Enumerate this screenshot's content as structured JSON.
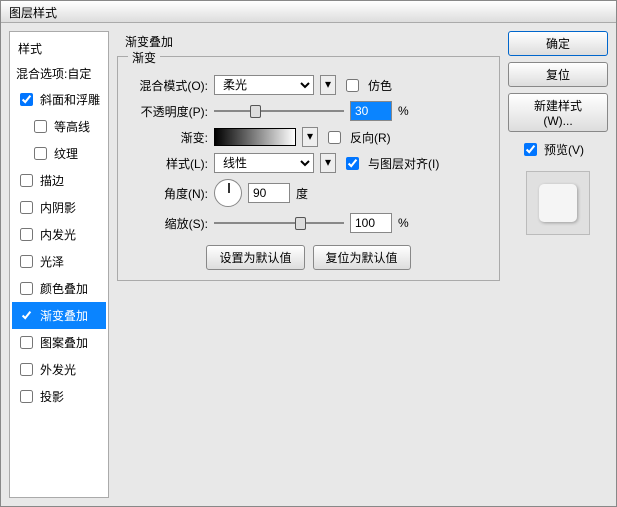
{
  "window": {
    "title": "图层样式"
  },
  "sidebar": {
    "title": "样式",
    "blend_option": "混合选项:自定",
    "items": [
      {
        "label": "斜面和浮雕",
        "checked": true
      },
      {
        "label": "等高线",
        "checked": false,
        "child": true
      },
      {
        "label": "纹理",
        "checked": false,
        "child": true
      },
      {
        "label": "描边",
        "checked": false
      },
      {
        "label": "内阴影",
        "checked": false
      },
      {
        "label": "内发光",
        "checked": false
      },
      {
        "label": "光泽",
        "checked": false
      },
      {
        "label": "颜色叠加",
        "checked": false
      },
      {
        "label": "渐变叠加",
        "checked": true,
        "selected": true
      },
      {
        "label": "图案叠加",
        "checked": false
      },
      {
        "label": "外发光",
        "checked": false
      },
      {
        "label": "投影",
        "checked": false
      }
    ]
  },
  "panel": {
    "title": "渐变叠加",
    "group": "渐变",
    "blend_mode": {
      "label": "混合模式(O):",
      "value": "柔光"
    },
    "dither": {
      "label": "仿色",
      "checked": false
    },
    "opacity": {
      "label": "不透明度(P):",
      "value": "30",
      "pct": "%"
    },
    "gradient": {
      "label": "渐变:"
    },
    "reverse": {
      "label": "反向(R)",
      "checked": false
    },
    "style": {
      "label": "样式(L):",
      "value": "线性"
    },
    "align": {
      "label": "与图层对齐(I)",
      "checked": true
    },
    "angle": {
      "label": "角度(N):",
      "value": "90",
      "unit": "度"
    },
    "scale": {
      "label": "缩放(S):",
      "value": "100",
      "pct": "%"
    },
    "set_default": "设置为默认值",
    "reset_default": "复位为默认值"
  },
  "right": {
    "ok": "确定",
    "cancel": "复位",
    "new_style": "新建样式(W)...",
    "preview": "预览(V)",
    "preview_checked": true
  }
}
